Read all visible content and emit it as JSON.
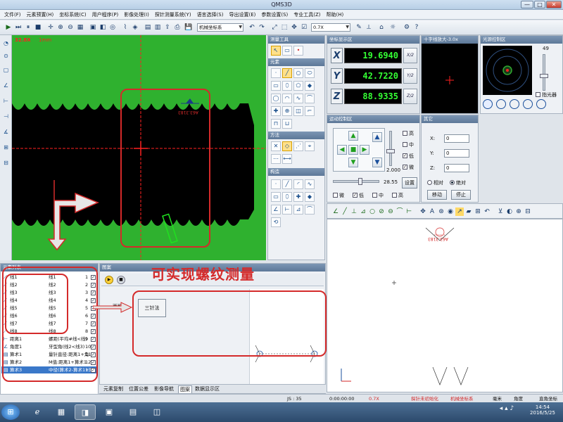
{
  "window": {
    "title": "QMS3D",
    "min": "—",
    "max": "□",
    "close": "✕"
  },
  "menu": [
    "文件(F)",
    "元素预置(H)",
    "坐标系统(C)",
    "用户程序(P)",
    "影像处理(I)",
    "探针测量系统(Y)",
    "语言选择(S)",
    "导出设置(E)",
    "参数设置(S)",
    "专业工具(Z)",
    "帮助(H)"
  ],
  "toolbar": {
    "coordinate_system": "机械坐标系",
    "zoom": "0.7X",
    "icons": [
      "play-icon",
      "step-icon",
      "pause-icon",
      "stop-icon"
    ]
  },
  "camera": {
    "readout": "32.8X",
    "scale": "1mm"
  },
  "toolbox": {
    "sections": [
      "测量工具",
      "元素",
      "方法",
      "构造"
    ]
  },
  "coord_panel": {
    "title": "坐标显示区",
    "rows": [
      {
        "axis": "X",
        "value": "19.6940",
        "half": "X/2"
      },
      {
        "axis": "Y",
        "value": "42.7220",
        "half": "Y/2"
      },
      {
        "axis": "Z",
        "value": "88.9335",
        "half": "Z/2"
      }
    ]
  },
  "cross_panel": {
    "title": "十字线放大-3.0x"
  },
  "light_panel": {
    "title": "光源控制区",
    "value": "49",
    "checkbox_label": "指光器"
  },
  "motion_panel": {
    "title": "运动控制区",
    "speed_options": [
      "高",
      "中",
      "低",
      "微"
    ],
    "speed_value": "2.000",
    "slider_value": "28.55",
    "bottom_options": [
      "微",
      "低",
      "中",
      "高"
    ],
    "settings_button": "设置"
  },
  "other_panel": {
    "title": "其它",
    "fields": [
      {
        "label": "X:",
        "value": "0"
      },
      {
        "label": "Y:",
        "value": "0"
      },
      {
        "label": "Z:",
        "value": "0"
      }
    ],
    "relative": "相对",
    "absolute": "绝对",
    "move": "移动",
    "stop": "停止"
  },
  "element_list": {
    "title": "元素列表",
    "rows": [
      {
        "icon": "line-icon",
        "name": "线1",
        "desc": "线1",
        "num": "1",
        "checked": true
      },
      {
        "icon": "line-icon",
        "name": "线2",
        "desc": "线2",
        "num": "2",
        "checked": true
      },
      {
        "icon": "line-icon",
        "name": "线3",
        "desc": "线3",
        "num": "3",
        "checked": true
      },
      {
        "icon": "line-icon",
        "name": "线4",
        "desc": "线4",
        "num": "4",
        "checked": true
      },
      {
        "icon": "line-icon",
        "name": "线5",
        "desc": "线5",
        "num": "5",
        "checked": true
      },
      {
        "icon": "line-icon",
        "name": "线6",
        "desc": "线6",
        "num": "6",
        "checked": true
      },
      {
        "icon": "line-icon",
        "name": "线7",
        "desc": "线7",
        "num": "7",
        "checked": true
      },
      {
        "icon": "line-icon",
        "name": "线8",
        "desc": "线8",
        "num": "8",
        "checked": true
      },
      {
        "icon": "distance-icon",
        "name": "距离1",
        "desc": "螺距(平均#线<线)",
        "num": "9",
        "checked": true
      },
      {
        "icon": "angle-icon",
        "name": "角度1",
        "desc": "牙型角(线2<线3)",
        "num": "10",
        "checked": true
      },
      {
        "icon": "calc-icon",
        "name": "算术1",
        "desc": "量针直径:距离1+角",
        "num": "11",
        "checked": true
      },
      {
        "icon": "calc-icon",
        "name": "算术2",
        "desc": "M值:距离1+算术1",
        "num": "12",
        "checked": true
      },
      {
        "icon": "calc-icon",
        "name": "算术3",
        "desc": "中径(算术2-算术1+3)",
        "num": "13",
        "checked": true,
        "selected": true
      }
    ]
  },
  "program_panel": {
    "title": "图案",
    "side_label": "面积",
    "method_button": "三针法",
    "tabs": [
      "元素复制",
      "位置公差",
      "影像导航",
      "图案",
      "数据显示区"
    ],
    "active_tab": 3
  },
  "annotation_text": "可实现螺纹测量",
  "status": {
    "js": "JS : 35",
    "time": "0:00:00:00",
    "zoom": "0.7X",
    "probe": "探针未初始化",
    "coord": "机械坐标系",
    "unit": "毫米",
    "angle": "角度",
    "mode": "直角坐标"
  },
  "taskbar": {
    "clock": "14:54",
    "date": "2016/5/25",
    "apps": [
      "start-icon",
      "ie-icon",
      "network-icon",
      "qms-icon",
      "image-icon",
      "folder-icon",
      "explorer-icon"
    ]
  },
  "graph": {
    "label": "A63.3183"
  },
  "colors": {
    "camera_green": "#2fb12f",
    "accent_red": "#d42a2a",
    "dro_green": "#34ff34"
  }
}
